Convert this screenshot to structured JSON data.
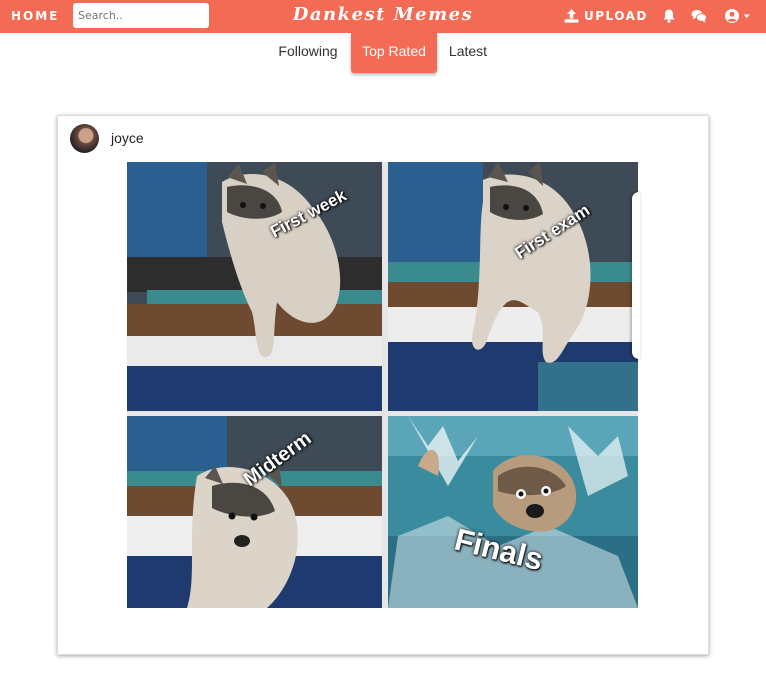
{
  "nav": {
    "home": "HOME",
    "search_placeholder": "Search..",
    "brand": "Dankest Memes",
    "upload": "UPLOAD",
    "icons": [
      "upload-icon",
      "bell-icon",
      "chat-icon",
      "user-circle-icon",
      "caret-down-icon"
    ],
    "accent_color": "#f36b54"
  },
  "tabs": [
    {
      "label": "Following",
      "active": false
    },
    {
      "label": "Top Rated",
      "active": true
    },
    {
      "label": "Latest",
      "active": false
    }
  ],
  "post": {
    "username": "joyce",
    "captions": [
      "First week",
      "First exam",
      "Midterm",
      "Finals"
    ]
  }
}
